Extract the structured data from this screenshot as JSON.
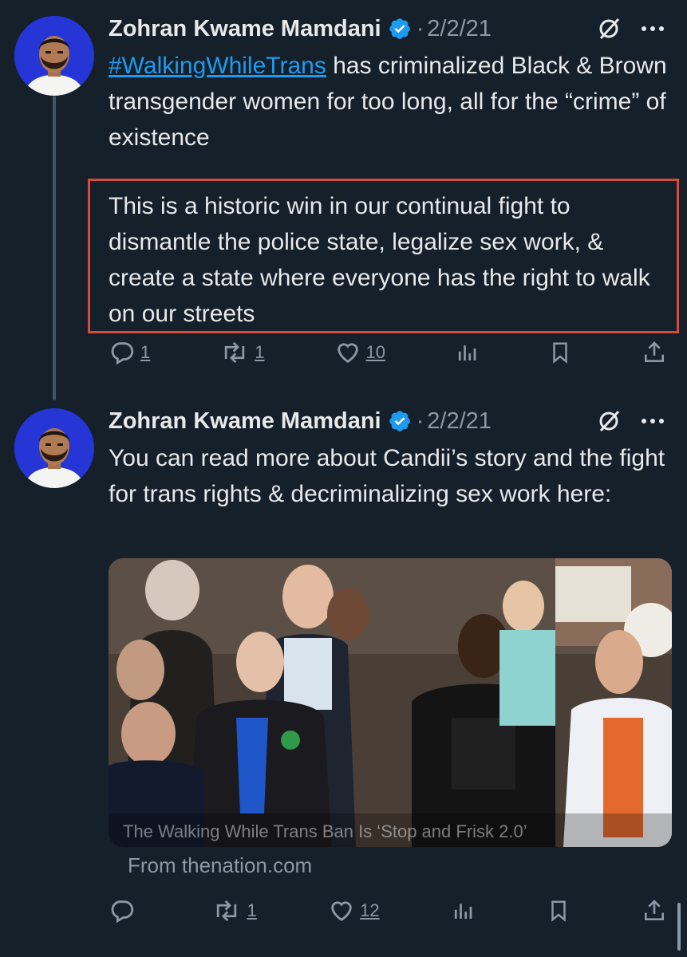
{
  "colors": {
    "background": "#15202b",
    "accent_link": "#1d9bf0",
    "muted": "#8b98a5",
    "highlight_box": "#d9493e",
    "verified_badge": "#1d9bf0"
  },
  "tweets": [
    {
      "author": "Zohran Kwame Mamdani",
      "separator": "·",
      "date": "2/2/21",
      "hashtag": "#WalkingWhileTrans",
      "text_after_hashtag": " has criminalized Black & Brown transgender women for too long, all for the “crime” of existence",
      "highlighted_text": "This is a historic win in our continual fight to dismantle the police state, legalize sex work, & create a state where everyone has the right to walk on our streets",
      "replies": "1",
      "retweets": "1",
      "likes": "10",
      "icons": [
        "grok-icon",
        "more-icon",
        "reply-icon",
        "retweet-icon",
        "like-icon",
        "views-icon",
        "bookmark-icon",
        "share-icon"
      ]
    },
    {
      "author": "Zohran Kwame Mamdani",
      "separator": "·",
      "date": "2/2/21",
      "text": "You can read more about Candii’s story and the fight for trans rights & decriminalizing sex work here:",
      "media_caption": "The Walking While Trans Ban Is ‘Stop and Frisk 2.0’",
      "source": "From thenation.com",
      "replies": "",
      "retweets": "1",
      "likes": "12",
      "icons": [
        "grok-icon",
        "more-icon",
        "reply-icon",
        "retweet-icon",
        "like-icon",
        "views-icon",
        "bookmark-icon",
        "share-icon"
      ]
    }
  ]
}
